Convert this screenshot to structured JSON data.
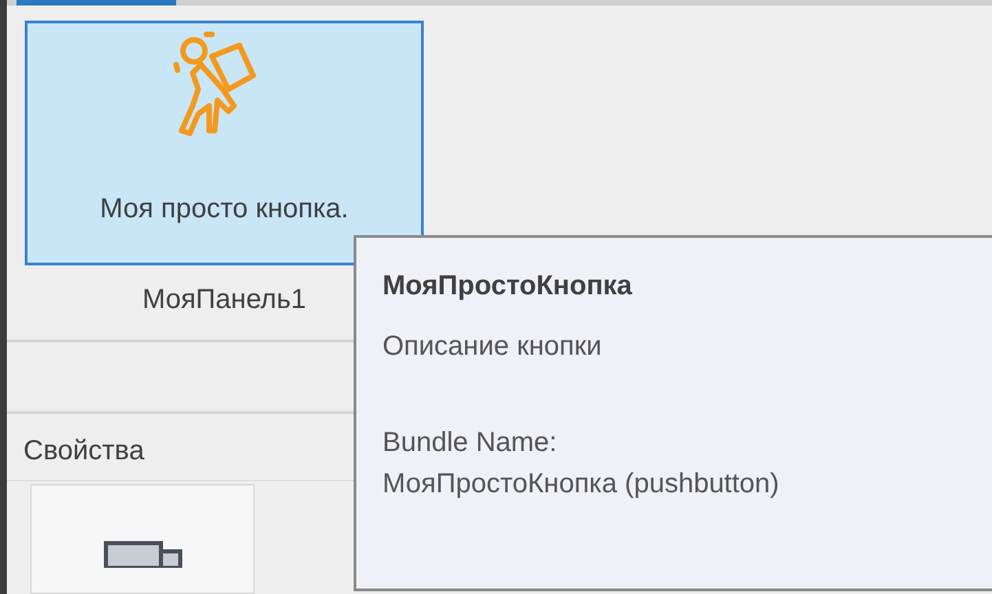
{
  "ribbon_panel": {
    "button": {
      "label": "Моя просто кнопка.",
      "selected": true
    },
    "panel_title": "МояПанель1"
  },
  "properties": {
    "title": "Свойства"
  },
  "tooltip": {
    "title": "МояПростоКнопка",
    "description": "Описание кнопки",
    "bundle_label": "Bundle Name:",
    "bundle_value": "МояПростоКнопка (pushbutton)"
  }
}
